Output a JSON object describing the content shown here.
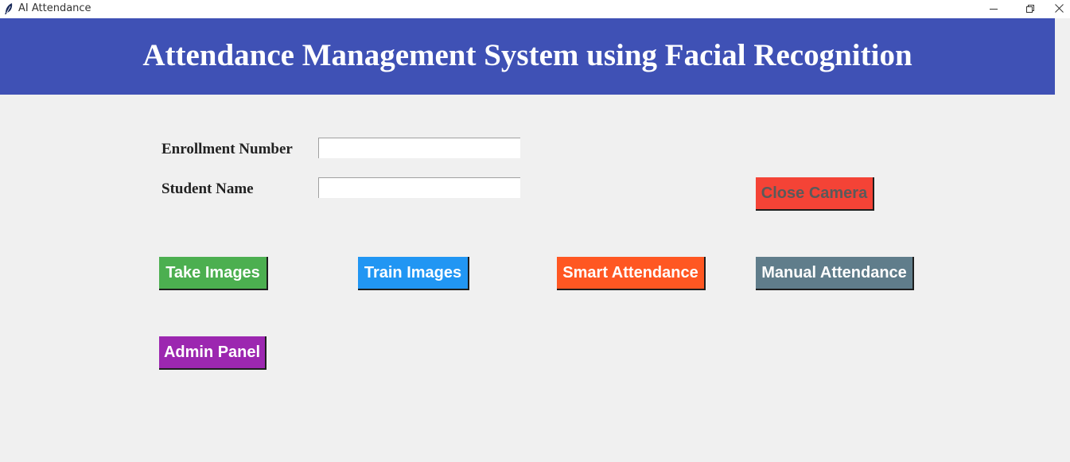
{
  "window": {
    "title": "AI Attendance",
    "icon": "feather-icon",
    "controls": [
      "minimize-icon",
      "restore-icon",
      "close-icon"
    ]
  },
  "header": {
    "title": "Attendance Management System using Facial Recognition",
    "background": "#3f51b5"
  },
  "form": {
    "enrollment_label": "Enrollment Number",
    "enrollment_value": "",
    "name_label": "Student Name",
    "name_value": ""
  },
  "buttons": {
    "close_camera": {
      "label": "Close Camera",
      "color": "#f44336"
    },
    "take_images": {
      "label": "Take Images",
      "color": "#4caf50"
    },
    "train_images": {
      "label": "Train Images",
      "color": "#2196f3"
    },
    "smart_attendance": {
      "label": "Smart Attendance",
      "color": "#ff5722"
    },
    "manual_attendance": {
      "label": "Manual Attendance",
      "color": "#607d8b"
    },
    "admin_panel": {
      "label": "Admin Panel",
      "color": "#9c27b0"
    }
  }
}
